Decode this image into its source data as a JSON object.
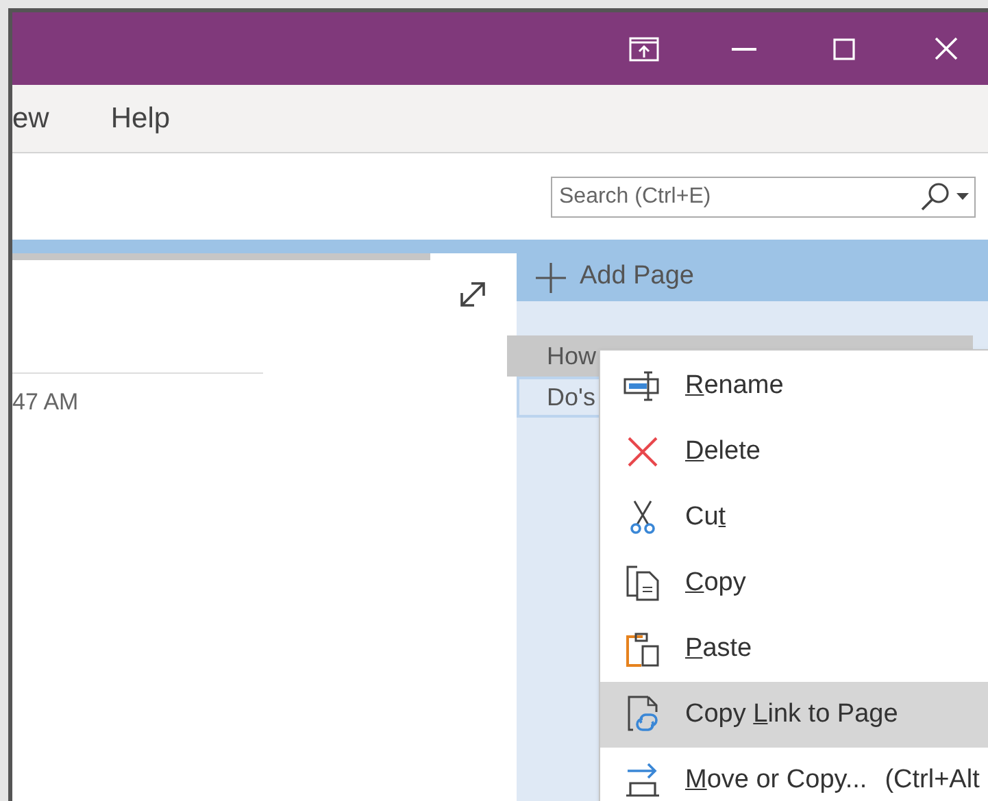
{
  "ribbon": {
    "tabs": [
      {
        "label": "ew",
        "selected": false
      },
      {
        "label": "Help",
        "selected": false
      }
    ]
  },
  "search": {
    "placeholder": "Search (Ctrl+E)"
  },
  "page": {
    "time": "47 AM"
  },
  "page_list": {
    "add_label": "Add Page",
    "pages": [
      {
        "title": "How",
        "selected": true
      },
      {
        "title": "Do's",
        "selected": false
      }
    ]
  },
  "context_menu": {
    "items": [
      {
        "kind": "rename",
        "key": "R",
        "after": "ename",
        "selected": false
      },
      {
        "kind": "delete",
        "key": "D",
        "after": "elete",
        "selected": false
      },
      {
        "kind": "cut",
        "before": "Cu",
        "key": "t",
        "selected": false
      },
      {
        "kind": "copy",
        "key": "C",
        "after": "opy",
        "selected": false
      },
      {
        "kind": "paste",
        "key": "P",
        "after": "aste",
        "selected": false
      },
      {
        "kind": "link",
        "before": "Copy ",
        "key": "L",
        "after": "ink to Page",
        "selected": true
      },
      {
        "kind": "move",
        "key": "M",
        "after": "ove or Copy...",
        "shortcut": "(Ctrl+Alt",
        "selected": false
      }
    ]
  }
}
